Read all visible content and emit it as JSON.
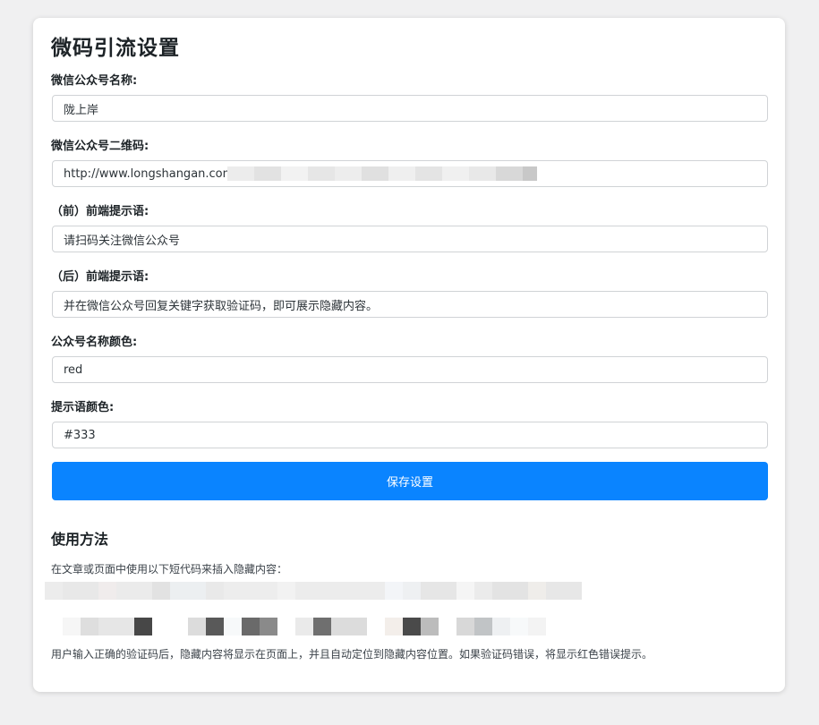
{
  "page": {
    "title": "微码引流设置"
  },
  "form": {
    "account_name": {
      "label": "微信公众号名称:",
      "value": "陇上岸"
    },
    "qrcode": {
      "label": "微信公众号二维码:",
      "value": "http://www.longshangan.com/"
    },
    "prompt_before": {
      "label": "（前）前端提示语:",
      "value": "请扫码关注微信公众号"
    },
    "prompt_after": {
      "label": "（后）前端提示语:",
      "value": "并在微信公众号回复关键字获取验证码，即可展示隐藏内容。"
    },
    "name_color": {
      "label": "公众号名称颜色:",
      "value": "red"
    },
    "prompt_color": {
      "label": "提示语颜色:",
      "value": "#333"
    },
    "save_label": "保存设置"
  },
  "usage": {
    "heading": "使用方法",
    "intro": "在文章或页面中使用以下短代码来插入隐藏内容：",
    "note": "用户输入正确的验证码后，隐藏内容将显示在页面上，并且自动定位到隐藏内容位置。如果验证码错误，将显示红色错误提示。"
  },
  "colors": {
    "accent": "#0a84ff",
    "background": "#f0f0f1",
    "card": "#ffffff"
  }
}
